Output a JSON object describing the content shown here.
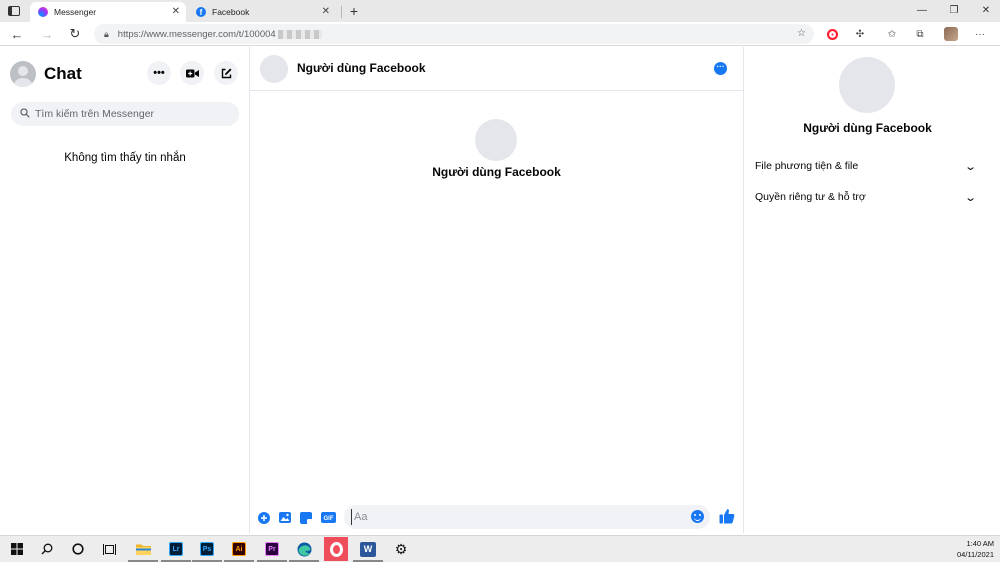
{
  "browser": {
    "tabs": [
      {
        "title": "Messenger",
        "active": true,
        "favicon_color": "#a033ff"
      },
      {
        "title": "Facebook",
        "active": false,
        "favicon_color": "#1877f2"
      }
    ],
    "new_tab_icon": "+",
    "window_controls": [
      "—",
      "❐",
      "✕"
    ],
    "url": "https://www.messenger.com/t/100004",
    "url_redacted": true
  },
  "messenger": {
    "sidebar": {
      "title": "Chat",
      "search_placeholder": "Tìm kiếm trên Messenger",
      "empty_text": "Không tìm thấy tin nhắn"
    },
    "conversation": {
      "contact_name": "Người dùng Facebook",
      "center_name": "Người dùng Facebook",
      "composer_placeholder": "Aa"
    },
    "details": {
      "name": "Người dùng Facebook",
      "sections": [
        {
          "label": "File phương tiện & file"
        },
        {
          "label": "Quyền riêng tư & hỗ trợ"
        }
      ]
    },
    "accent_color": "#1877f2"
  },
  "taskbar": {
    "time": "1:40 AM",
    "date": "04/11/2021",
    "apps": [
      {
        "label": "Lr",
        "bg": "#001e36",
        "fg": "#31a8ff"
      },
      {
        "label": "Ps",
        "bg": "#001e36",
        "fg": "#31a8ff"
      },
      {
        "label": "Ai",
        "bg": "#330000",
        "fg": "#ff9a00"
      },
      {
        "label": "Pr",
        "bg": "#2a003f",
        "fg": "#e77cff"
      },
      {
        "label": "W",
        "bg": "#ffffff",
        "fg": "#2b579a"
      }
    ]
  }
}
